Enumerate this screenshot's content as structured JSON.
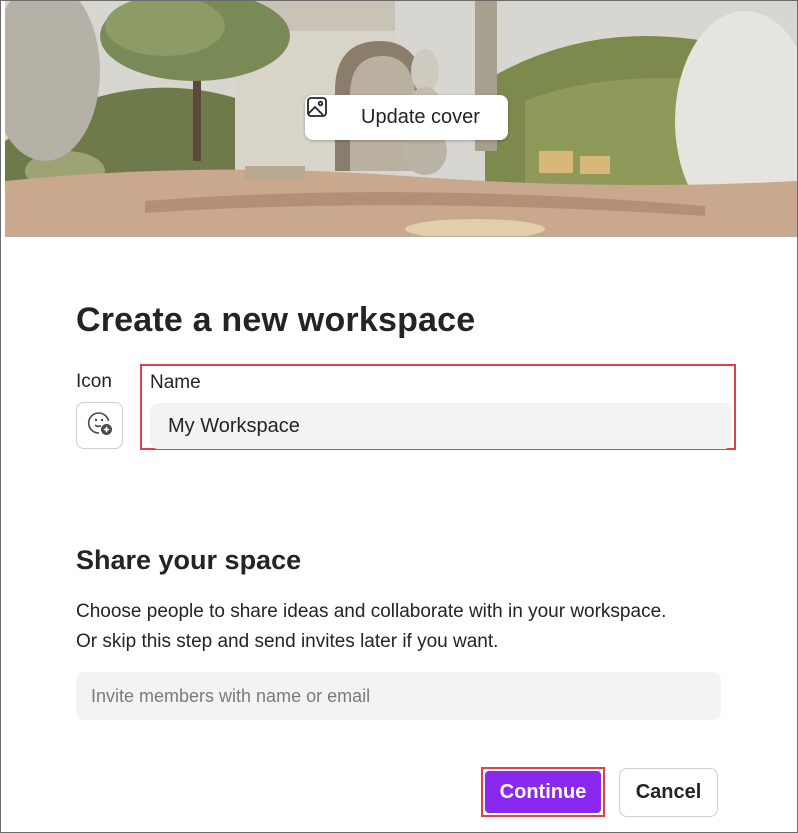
{
  "cover": {
    "update_button_label": "Update cover",
    "update_button_icon": "image-icon"
  },
  "form": {
    "title": "Create a new workspace",
    "icon_label": "Icon",
    "icon_picker_icon": "emoji-add-icon",
    "name_label": "Name",
    "name_value": "My Workspace"
  },
  "share": {
    "title": "Share your space",
    "description_line1": "Choose people to share ideas and collaborate with in your workspace.",
    "description_line2": "Or skip this step and send invites later if you want.",
    "invite_placeholder": "Invite members with name or email"
  },
  "actions": {
    "continue_label": "Continue",
    "cancel_label": "Cancel"
  },
  "colors": {
    "primary": "#8b28f0",
    "highlight": "#e0404d",
    "input_background": "#f3f3f3"
  }
}
